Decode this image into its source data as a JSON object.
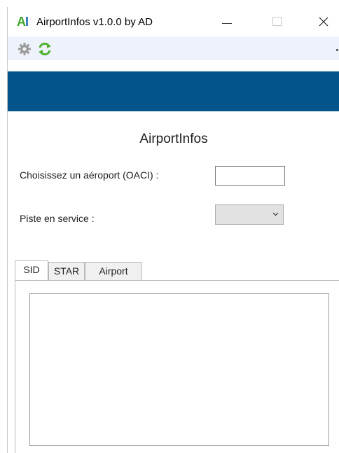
{
  "window": {
    "title": "AirportInfos v1.0.0 by AD",
    "icon_text": {
      "first": "A",
      "second": "I"
    }
  },
  "toolbar": {
    "settings_icon": "gear-icon",
    "refresh_icon": "refresh-icon"
  },
  "colors": {
    "banner": "#02558a",
    "toolbar": "#eef3fb",
    "icon_green": "#3fa62b",
    "icon_blue": "#1f6fb5"
  },
  "main": {
    "heading": "AirportInfos",
    "oaci_label": "Choisissez un aéroport (OACI) :",
    "oaci_value": "",
    "piste_label": "Piste en service :",
    "piste_value": ""
  },
  "tabs": [
    {
      "label": "SID",
      "active": true
    },
    {
      "label": "STAR",
      "active": false
    },
    {
      "label": "Airport",
      "active": false
    }
  ],
  "list_items": []
}
